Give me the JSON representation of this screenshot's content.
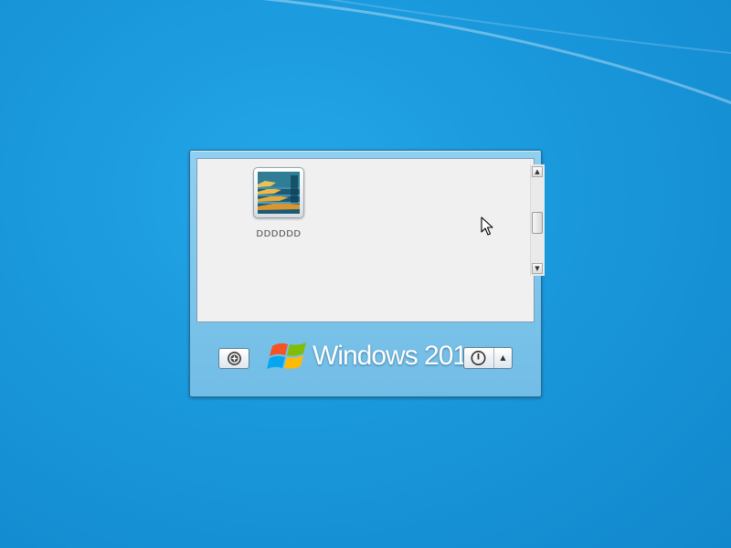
{
  "login": {
    "user": {
      "name": "DDDDDD",
      "avatar_icon": "staircase-photo-icon"
    },
    "scrollbar": {
      "up_glyph": "▲",
      "down_glyph": "▼"
    },
    "ease_of_access_icon": "ease-of-access-icon",
    "branding": {
      "text": "Windows 2010",
      "logo_icon": "windows-flag-icon"
    },
    "power": {
      "icon": "power-icon",
      "options_glyph": "▲"
    }
  },
  "colors": {
    "desktop": "#1a98dc",
    "panel": "#7bc4ea",
    "list_bg": "#f0f0f0"
  }
}
